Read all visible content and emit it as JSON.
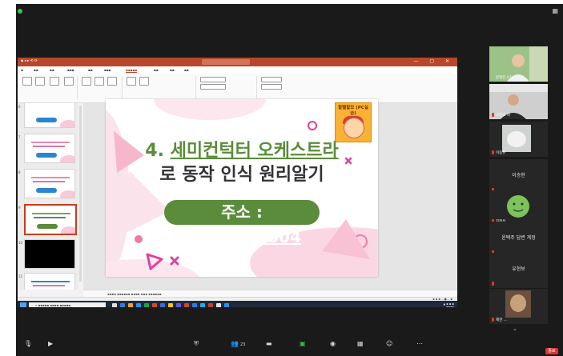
{
  "slide": {
    "title_line1_prefix": "4. ",
    "title_line1_main": "세미컨턱터 오케스트라",
    "title_line2": "로 동작 인식 원리알기",
    "address_label": "주소 : ",
    "address_url": "bit.ly/aiai004",
    "badge_text": "할렐할모 (PC실습)"
  },
  "participants": [
    {
      "name": "",
      "label": "문택진 (나)",
      "muted": false
    },
    {
      "name": "",
      "label": "고현교 하",
      "muted": true
    },
    {
      "name": "",
      "label": "이동훈",
      "muted": true
    },
    {
      "name": "이승현",
      "label": "",
      "muted": true
    },
    {
      "name": "",
      "label": "지정은",
      "muted": true
    },
    {
      "name": "윤택주 답변 계정",
      "label": "",
      "muted": true
    },
    {
      "name": "유현보",
      "label": "",
      "muted": true
    },
    {
      "name": "",
      "label": "제한 ...",
      "muted": true
    }
  ],
  "toolbar": {
    "participants_count": "23",
    "end_label": "종료"
  },
  "colors": {
    "accent_green": "#5b8c3c",
    "powerpoint_red": "#b7472a",
    "pink": "#f7c9d9"
  }
}
